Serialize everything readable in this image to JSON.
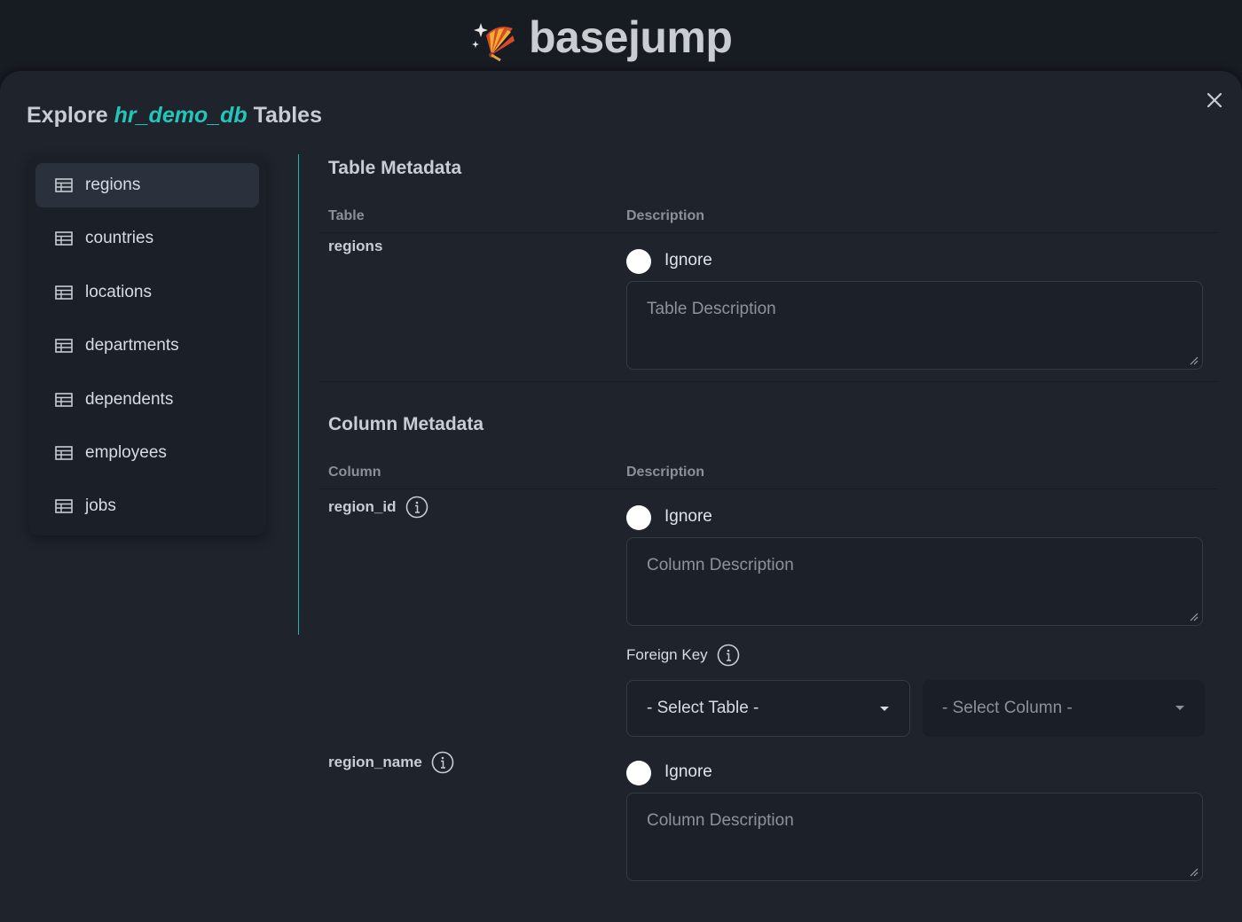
{
  "app": {
    "name": "basejump"
  },
  "header": {
    "title_prefix": "Explore",
    "db_name": "hr_demo_db",
    "title_suffix": "Tables"
  },
  "close_icon": "close-icon",
  "sidebar": {
    "items": [
      {
        "label": "regions",
        "icon": "table-icon",
        "active": true
      },
      {
        "label": "countries",
        "icon": "table-icon"
      },
      {
        "label": "locations",
        "icon": "table-icon"
      },
      {
        "label": "departments",
        "icon": "table-icon"
      },
      {
        "label": "dependents",
        "icon": "table-icon"
      },
      {
        "label": "employees",
        "icon": "table-icon"
      },
      {
        "label": "jobs",
        "icon": "table-icon"
      }
    ]
  },
  "table_meta": {
    "title": "Table Metadata",
    "col_table": "Table",
    "col_description": "Description",
    "table_name": "regions",
    "ignore_label": "Ignore",
    "description_placeholder": "Table Description"
  },
  "column_meta": {
    "title": "Column Metadata",
    "col_column": "Column",
    "col_description": "Description",
    "columns": [
      {
        "name": "region_id",
        "ignore_label": "Ignore",
        "description_placeholder": "Column Description",
        "foreign_key_label": "Foreign Key",
        "select_table": "- Select Table -",
        "select_column": "- Select Column -"
      },
      {
        "name": "region_name",
        "ignore_label": "Ignore",
        "description_placeholder": "Column Description"
      }
    ]
  },
  "colors": {
    "accent": "#23c6b8",
    "background": "#1e232c",
    "page": "#151920"
  }
}
